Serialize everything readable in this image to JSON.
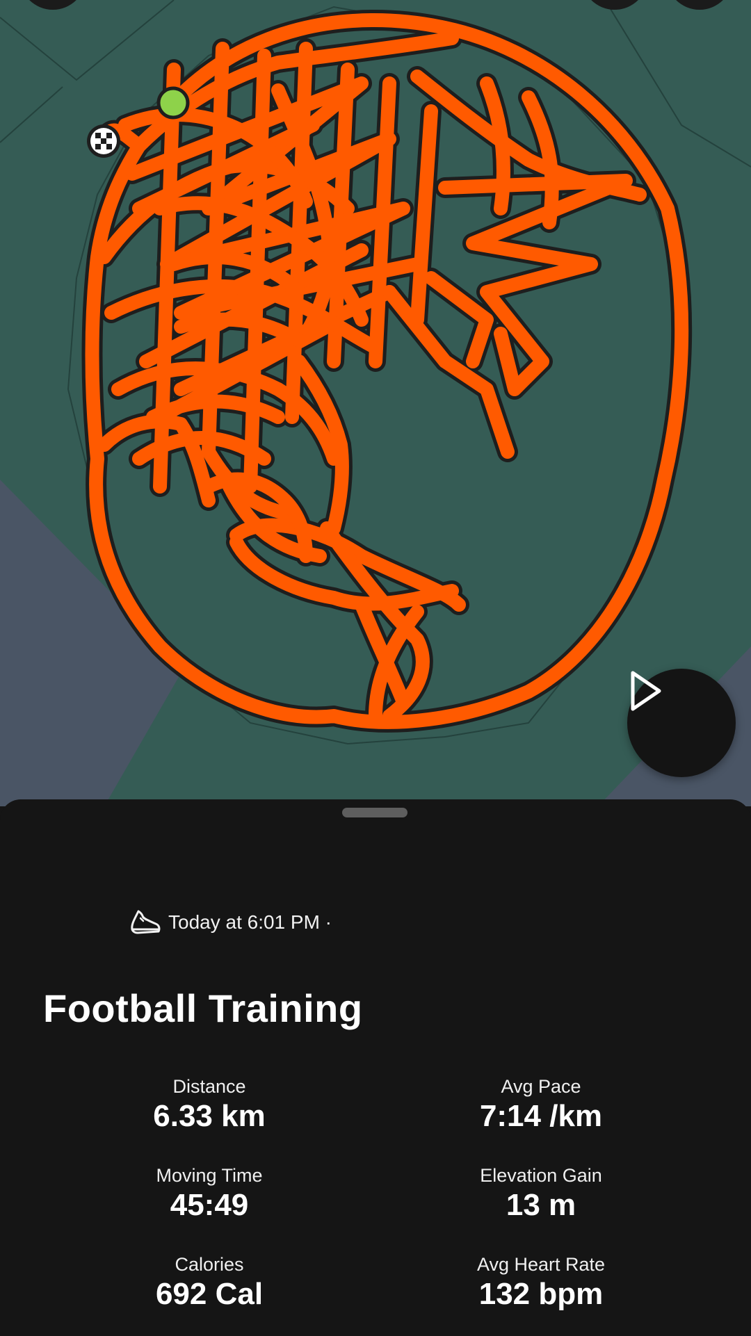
{
  "activity": {
    "meta_text": "Today at 6:01 PM ·",
    "title": "Football Training"
  },
  "stats": [
    {
      "label": "Distance",
      "value": "6.33 km"
    },
    {
      "label": "Avg Pace",
      "value": "7:14 /km"
    },
    {
      "label": "Moving Time",
      "value": "45:49"
    },
    {
      "label": "Elevation Gain",
      "value": "13 m"
    },
    {
      "label": "Calories",
      "value": "692 Cal"
    },
    {
      "label": "Avg Heart Rate",
      "value": "132 bpm"
    }
  ],
  "icons": {
    "activity": "running-shoe-icon",
    "play": "play-icon",
    "start": "start-marker-icon",
    "finish": "finish-flag-icon"
  },
  "colors": {
    "route": "#ff5a00",
    "route_outline": "#1e1e1e",
    "map_green": "#355c55",
    "map_slate": "#4a5565",
    "start_marker": "#8ed24a",
    "sheet_bg": "#151515"
  }
}
